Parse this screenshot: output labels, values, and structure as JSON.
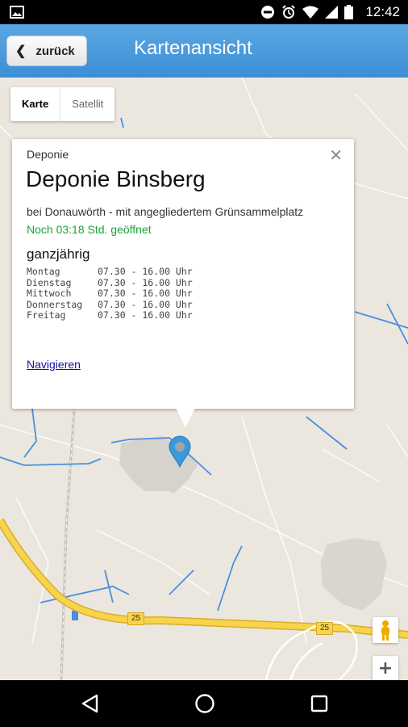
{
  "status_bar": {
    "time": "12:42",
    "left_icon": "image-icon",
    "icons": [
      "do-not-disturb-icon",
      "alarm-icon",
      "wifi-icon",
      "signal-icon",
      "battery-icon"
    ]
  },
  "app_bar": {
    "back_label": "zurück",
    "title": "Kartenansicht"
  },
  "map": {
    "map_type": {
      "active": "Karte",
      "inactive": "Satellit"
    },
    "road_labels": [
      "25",
      "25"
    ],
    "info_window": {
      "category": "Deponie",
      "title": "Deponie Binsberg",
      "subtitle": "bei Donauwörth - mit angegliedertem Grünsammelplatz",
      "open_status": "Noch 03:18 Std. geöffnet",
      "season": "ganzjährig",
      "hours": [
        {
          "day": "Montag",
          "time": "07.30 - 16.00 Uhr"
        },
        {
          "day": "Dienstag",
          "time": "07.30 - 16.00 Uhr"
        },
        {
          "day": "Mittwoch",
          "time": "07.30 - 16.00 Uhr"
        },
        {
          "day": "Donnerstag",
          "time": "07.30 - 16.00 Uhr"
        },
        {
          "day": "Freitag",
          "time": "07.30 - 16.00 Uhr"
        }
      ],
      "navigate_link": "Navigieren"
    },
    "zoom_in_label": "+"
  },
  "colors": {
    "app_bar": "#3c8fd6",
    "open_status": "#1aa33a",
    "road": "#f7d44a",
    "water": "#4a8ee0",
    "map_background": "#ebe7df"
  }
}
